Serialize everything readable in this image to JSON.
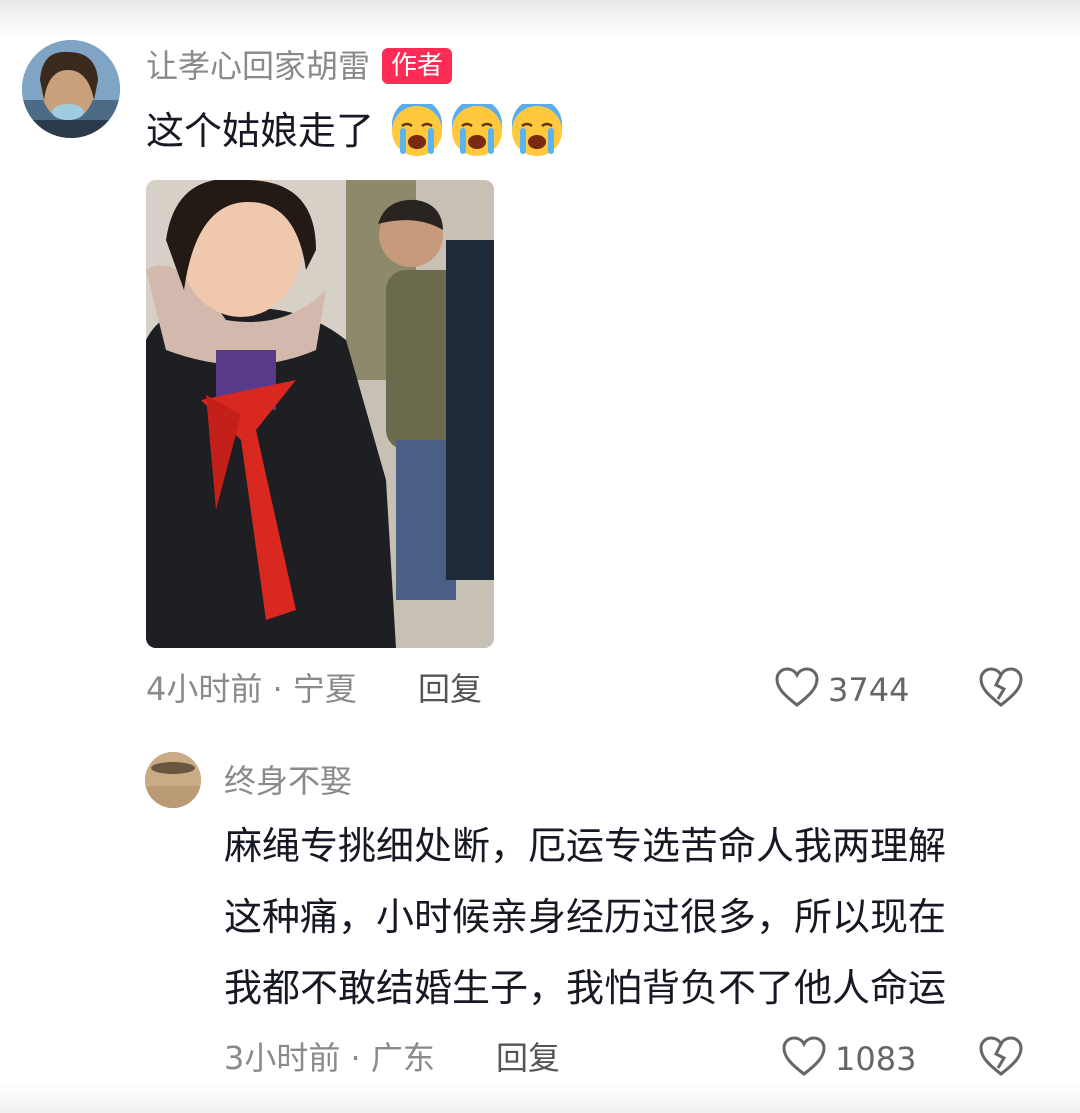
{
  "comment": {
    "username": "让孝心回家胡雷",
    "badge": "作者",
    "text": "这个姑娘走了",
    "emojis": [
      "loudly-crying-face",
      "loudly-crying-face",
      "loudly-crying-face"
    ],
    "meta": "4小时前 · 宁夏",
    "reply_label": "回复",
    "likes": "3744"
  },
  "reply": {
    "username": "终身不娶",
    "lines": [
      "麻绳专挑细处断，厄运专选苦命人我两理解",
      "这种痛，小时候亲身经历过很多，所以现在",
      "我都不敢结婚生子，我怕背负不了他人命运"
    ],
    "meta": "3小时前 · 广东",
    "reply_label": "回复",
    "likes": "1083"
  },
  "colors": {
    "badge": "#fe2c55",
    "secondary_text": "#8a8a8a",
    "primary_text": "#161823"
  }
}
